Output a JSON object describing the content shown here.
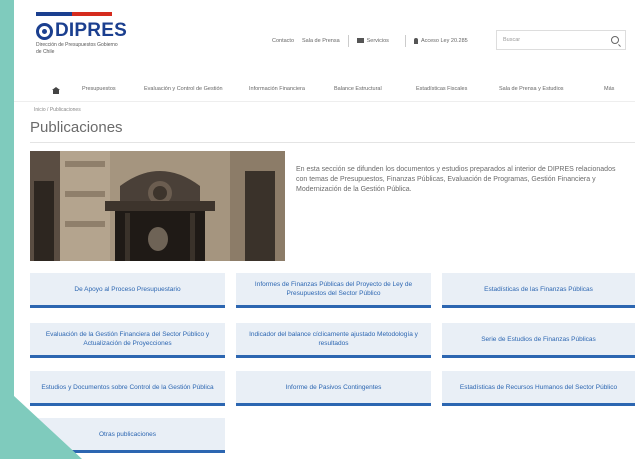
{
  "brand": {
    "logo_text": "DIPRES",
    "subtitle": "Dirección de Presupuestos Gobierno de Chile"
  },
  "top_links": {
    "contact": "Contacto",
    "press": "Sala de Prensa",
    "services": "Servicios",
    "access": "Acceso Ley 20.285"
  },
  "search": {
    "placeholder": "Buscar"
  },
  "nav": {
    "items": [
      "Presupuestos",
      "Evaluación y Control de Gestión",
      "Información Financiera",
      "Balance Estructural",
      "Estadísticas Fiscales",
      "Sala de Prensa y Estudios",
      "Más"
    ]
  },
  "breadcrumb": "Inicio / Publicaciones",
  "page_title": "Publicaciones",
  "intro_text": "En esta sección se difunden los documentos y estudios preparados al interior de DIPRES relacionados con temas de Presupuestos, Finanzas Públicas, Evaluación de Programas, Gestión Financiera y Modernización de la Gestión Pública.",
  "publications": [
    "De Apoyo al Proceso Presupuestario",
    "Informes de Finanzas Públicas del Proyecto de Ley de Presupuestos del Sector Público",
    "Estadísticas de las Finanzas Públicas",
    "Evaluación de la Gestión Financiera del Sector Público y Actualización de Proyecciones",
    "Indicador del balance cíclicamente ajustado Metodología y resultados",
    "Serie de Estudios de Finanzas Públicas",
    "Estudios y Documentos sobre Control de la Gestión Pública",
    "Informe de Pasivos Contingentes",
    "Estadísticas de Recursos Humanos del Sector Público",
    "Otras publicaciones"
  ],
  "colors": {
    "accent": "#2c66b1",
    "tile_bg": "#e9eff6",
    "frame_bg": "#7fcbbd",
    "brand_blue": "#1b3f8f",
    "brand_red": "#d52b1e"
  }
}
